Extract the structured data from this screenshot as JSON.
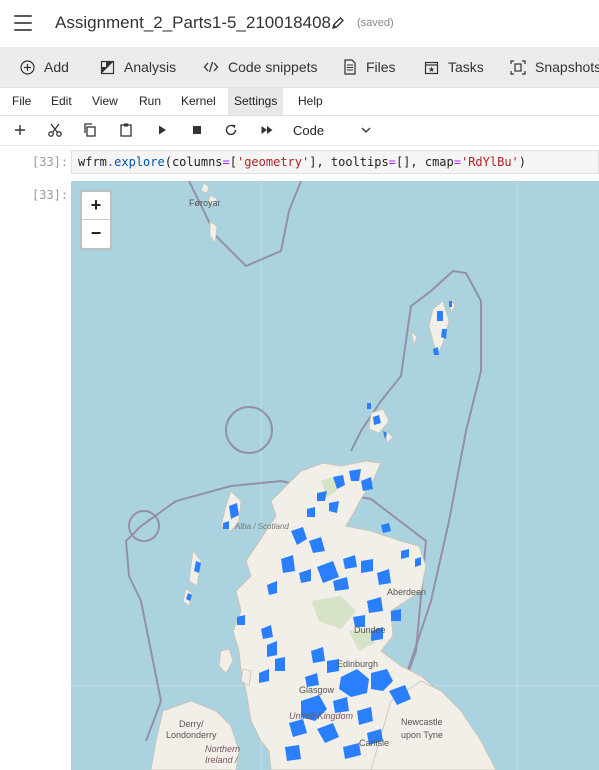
{
  "header": {
    "notebook_title": "Assignment_2_Parts1-5_210018408",
    "save_status": "(saved)"
  },
  "toolbar": {
    "items": [
      {
        "label": "Add",
        "icon": "plus-circle-icon"
      },
      {
        "label": "Analysis",
        "icon": "analysis-icon"
      },
      {
        "label": "Code snippets",
        "icon": "code-icon"
      },
      {
        "label": "Files",
        "icon": "file-icon"
      },
      {
        "label": "Tasks",
        "icon": "tasks-icon"
      },
      {
        "label": "Snapshots",
        "icon": "snapshot-icon"
      }
    ]
  },
  "menu": {
    "items": [
      "File",
      "Edit",
      "View",
      "Run",
      "Kernel",
      "Settings",
      "Help"
    ],
    "active": "Settings"
  },
  "cell_toolbar": {
    "cell_type": "Code",
    "tools": [
      "add-icon",
      "cut-icon",
      "copy-icon",
      "paste-icon",
      "run-icon",
      "stop-icon",
      "restart-icon",
      "fast-forward-icon"
    ]
  },
  "cell": {
    "in_prompt": "[33]:",
    "out_prompt": "[33]:",
    "code": {
      "obj": "wfrm",
      "dot": ".",
      "fn": "explore",
      "p1": "(columns",
      "eq1": "=",
      "p2": "[",
      "s1": "'geometry'",
      "p3": "], tooltips",
      "eq2": "=",
      "p4": "[], cmap",
      "eq3": "=",
      "s2": "'RdYlBu'",
      "p5": ")"
    }
  },
  "map": {
    "zoom_in": "+",
    "zoom_out": "−",
    "labels": {
      "faroe": "Føroyar",
      "scotland": "Alba / Scotland",
      "aberdeen": "Aberdeen",
      "dundee": "Dundee",
      "edinburgh": "Edinburgh",
      "glasgow": "Glasgow",
      "uk": "United Kingdom",
      "newcastle1": "Newcastle",
      "newcastle2": "upon Tyne",
      "carlisle": "Carlisle",
      "derry1": "Derry/",
      "derry2": "Londonderry",
      "ni1": "Northern",
      "ni2": "Ireland /"
    },
    "colors": {
      "sea": "#aad3df",
      "land": "#f2efe9",
      "feature": "#2a7fff"
    }
  }
}
